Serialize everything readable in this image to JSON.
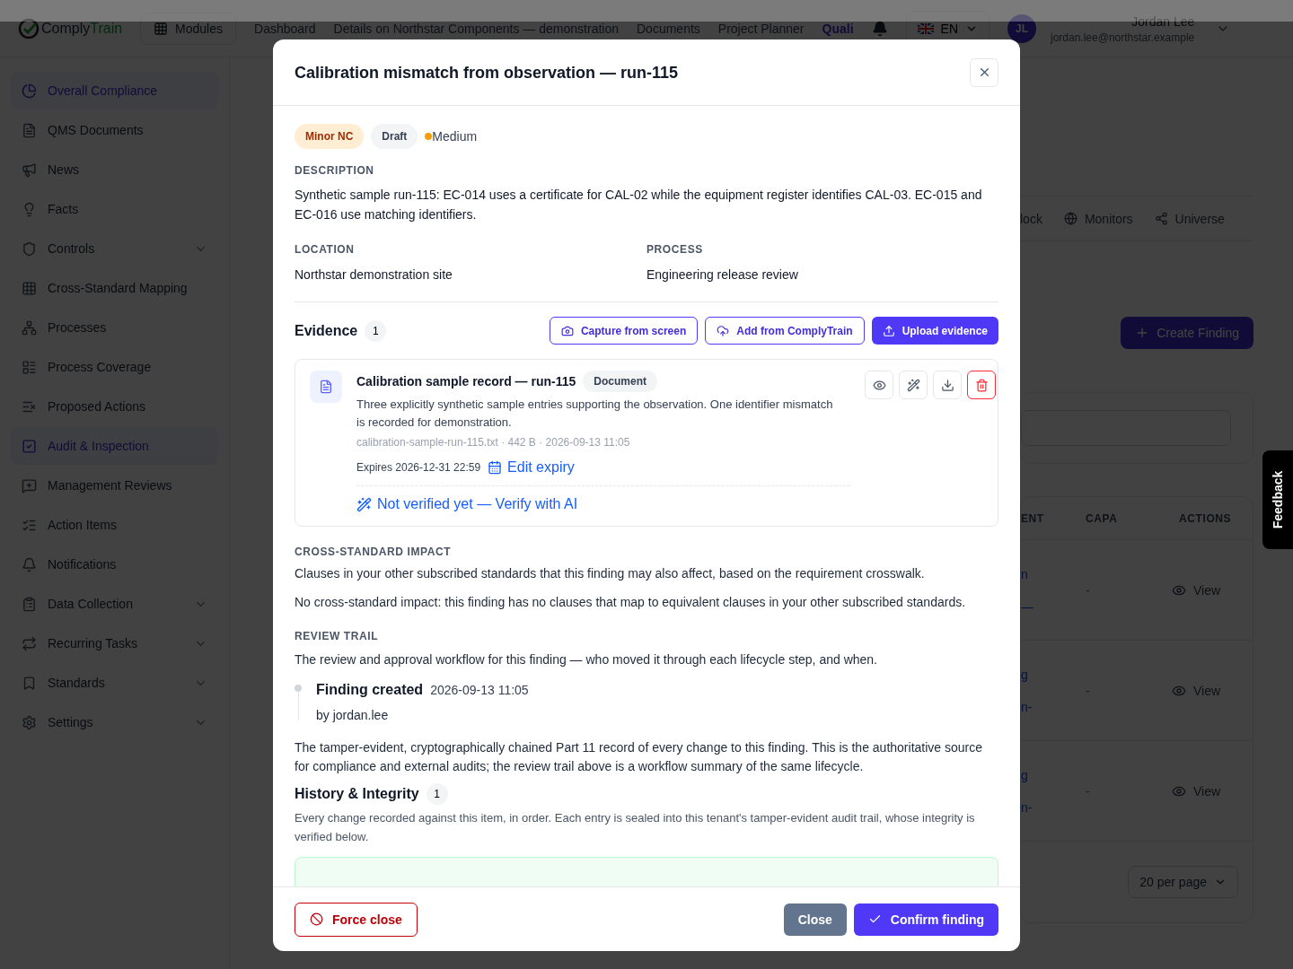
{
  "header": {
    "brand_a": "Comply",
    "brand_b": "Train",
    "modules_button": "Modules",
    "nav": [
      {
        "label": "Dashboard",
        "selected": false
      },
      {
        "label": "Details on Northstar Components — demonstration",
        "selected": false
      },
      {
        "label": "Documents",
        "selected": false
      },
      {
        "label": "Project Planner",
        "selected": false
      },
      {
        "label": "Quali",
        "selected": true
      }
    ],
    "language": "EN",
    "user": {
      "initials": "JL",
      "name": "Jordan Lee",
      "email": "jordan.lee@northstar.example"
    }
  },
  "sidebar": {
    "items": [
      {
        "label": "Overall Compliance",
        "selected": true,
        "expandable": false
      },
      {
        "label": "QMS Documents",
        "selected": false,
        "expandable": false
      },
      {
        "label": "News",
        "selected": false,
        "expandable": false
      },
      {
        "label": "Facts",
        "selected": false,
        "expandable": false
      },
      {
        "label": "Controls",
        "selected": false,
        "expandable": true
      },
      {
        "label": "Cross-Standard Mapping",
        "selected": false,
        "expandable": false
      },
      {
        "label": "Processes",
        "selected": false,
        "expandable": false
      },
      {
        "label": "Process Coverage",
        "selected": false,
        "expandable": false
      },
      {
        "label": "Proposed Actions",
        "selected": false,
        "expandable": false
      },
      {
        "label": "Audit & Inspection",
        "selected": true,
        "expandable": false
      },
      {
        "label": "Management Reviews",
        "selected": false,
        "expandable": false
      },
      {
        "label": "Action Items",
        "selected": false,
        "expandable": false
      },
      {
        "label": "Notifications",
        "selected": false,
        "expandable": false
      },
      {
        "label": "Data Collection",
        "selected": false,
        "expandable": true
      },
      {
        "label": "Recurring Tasks",
        "selected": false,
        "expandable": true
      },
      {
        "label": "Standards",
        "selected": false,
        "expandable": true
      },
      {
        "label": "Settings",
        "selected": false,
        "expandable": true
      }
    ]
  },
  "main": {
    "tabs": [
      "lock",
      "Monitors",
      "Universe"
    ],
    "create_button": "Create Finding",
    "table": {
      "columns": [
        "ENT",
        "CAPA",
        "ACTIONS"
      ],
      "rows": [
        {
          "column_1": [
            "n",
            "—"
          ],
          "capa": "-",
          "action": "View"
        },
        {
          "column_1": [
            "g",
            "n-"
          ],
          "capa": "-",
          "action": "View"
        },
        {
          "column_1": [
            "g",
            "n-"
          ],
          "capa": "-",
          "action": "View"
        }
      ]
    },
    "per_page": "20 per page"
  },
  "feedback": "Feedback",
  "modal": {
    "title": "Calibration mismatch from observation — run-115",
    "badges": [
      {
        "label": "Minor NC",
        "kind": "type"
      },
      {
        "label": "Draft",
        "kind": "status"
      }
    ],
    "severity": {
      "label": "Medium",
      "color": "#f59e0b"
    },
    "description_label": "DESCRIPTION",
    "description": "Synthetic sample run-115: EC-014 uses a certificate for CAL-02 while the equipment register identifies CAL-03. EC-015 and EC-016 use matching identifiers.",
    "fields": [
      {
        "label": "LOCATION",
        "value": "Northstar demonstration site"
      },
      {
        "label": "PROCESS",
        "value": "Engineering release review"
      }
    ],
    "evidence": {
      "title": "Evidence",
      "count": "1",
      "buttons": [
        {
          "label": "Capture from screen",
          "kind": "camera"
        },
        {
          "label": "Add from ComplyTrain",
          "kind": "cloud"
        },
        {
          "label": "Upload evidence",
          "kind": "upload"
        }
      ],
      "items": [
        {
          "title": "Calibration sample record — run-115",
          "type": "Document",
          "description": "Three explicitly synthetic sample entries supporting the observation. One identifier mismatch is recorded for demonstration.",
          "meta": "calibration-sample-run-115.txt · 442 B · 2026-09-13 11:05",
          "expires": "Expires 2026-12-31 22:59",
          "edit_expiry": "Edit expiry",
          "verify": "Not verified yet — Verify with AI"
        }
      ]
    },
    "cross_standard": {
      "heading": "CROSS-STANDARD IMPACT",
      "intro": "Clauses in your other subscribed standards that this finding may also affect, based on the requirement crosswalk.",
      "text": "No cross-standard impact: this finding has no clauses that map to equivalent clauses in your other subscribed standards."
    },
    "review_trail": {
      "heading": "REVIEW TRAIL",
      "intro": "The review and approval workflow for this finding — who moved it through each lifecycle step, and when.",
      "entries": [
        {
          "event": "Finding created",
          "time": "2026-09-13 11:05",
          "by": "by jordan.lee"
        }
      ]
    },
    "part11_text": "The tamper-evident, cryptographically chained Part 11 record of every change to this finding. This is the authoritative source for compliance and external audits; the review trail above is a workflow summary of the same lifecycle.",
    "history": {
      "title": "History & Integrity",
      "count": "1",
      "intro": "Every change recorded against this item, in order. Each entry is sealed into this tenant's tamper-evident audit trail, whose integrity is verified below."
    },
    "footer": {
      "force_close": "Force close",
      "close": "Close",
      "confirm": "Confirm finding"
    }
  }
}
